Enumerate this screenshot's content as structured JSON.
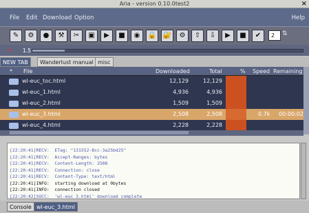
{
  "window": {
    "title": "Aria - version 0.10.0test2",
    "close_glyph": "×"
  },
  "menu": {
    "file": "File",
    "edit": "Edit",
    "download": "Download",
    "option": "Option",
    "help": "Help"
  },
  "toolbar": {
    "buttons": [
      {
        "icon": "pencil-icon",
        "glyph": "✎"
      },
      {
        "icon": "gear-icon",
        "glyph": "⚙"
      },
      {
        "icon": "orange-circle-icon",
        "glyph": "●"
      },
      {
        "icon": "wrench-icon",
        "glyph": "⚒"
      },
      {
        "icon": "scissors-icon",
        "glyph": "✂"
      },
      {
        "icon": "box-icon",
        "glyph": "▣"
      },
      {
        "icon": "play-icon",
        "glyph": "▶"
      },
      {
        "icon": "stop-icon",
        "glyph": "■"
      },
      {
        "icon": "record-icon",
        "glyph": "◉"
      },
      {
        "icon": "lock-icon",
        "glyph": "🔒"
      },
      {
        "icon": "lock-alt-icon",
        "glyph": "🔐"
      },
      {
        "icon": "settings-icon",
        "glyph": "⚙"
      },
      {
        "icon": "arrow-up-icon",
        "glyph": "⇧"
      },
      {
        "icon": "arrow-down-icon",
        "glyph": "⇩"
      },
      {
        "icon": "play-small-icon",
        "glyph": "▶"
      },
      {
        "icon": "stop-small-icon",
        "glyph": "■"
      },
      {
        "icon": "check-icon",
        "glyph": "✔"
      }
    ],
    "thread_count": "2",
    "spin_arrows": "⇅"
  },
  "speed": {
    "label": "1.5",
    "level": 0.12
  },
  "tabs": [
    {
      "label": "NEW TAB",
      "active": true
    },
    {
      "label": "Wanderlust manual",
      "active": false
    },
    {
      "label": "misc",
      "active": false
    }
  ],
  "columns": {
    "sel": "*",
    "file": "File",
    "downloaded": "Downloaded",
    "total": "Total",
    "percent": "%",
    "speed": "Speed",
    "remaining": "Remaining"
  },
  "files": [
    {
      "name": "wl-euc_toc.html",
      "downloaded": "12,129",
      "total": "12,129",
      "speed": "",
      "remaining": "",
      "selected": false
    },
    {
      "name": "wl-euc_1.html",
      "downloaded": "4,936",
      "total": "4,936",
      "speed": "",
      "remaining": "",
      "selected": false
    },
    {
      "name": "wl-euc_2.html",
      "downloaded": "1,509",
      "total": "1,509",
      "speed": "",
      "remaining": "",
      "selected": false
    },
    {
      "name": "wl-euc_3.html",
      "downloaded": "2,508",
      "total": "2,508",
      "speed": "0.7k",
      "remaining": "00:00:02",
      "selected": true
    },
    {
      "name": "wl-euc_4.html",
      "downloaded": "2,228",
      "total": "2,228",
      "speed": "",
      "remaining": "",
      "selected": false
    }
  ],
  "log": [
    {
      "text": "[22:20:41]RECV:  ETag: \"131552-8cc-3a25bd25\"",
      "bold": false
    },
    {
      "text": "[22:20:41]RECV:  Accept-Ranges: bytes",
      "bold": false
    },
    {
      "text": "[22:20:41]RECV:  Content-Length: 2508",
      "bold": false
    },
    {
      "text": "[22:20:41]RECV:  Connection: close",
      "bold": false
    },
    {
      "text": "[22:20:41]RECV:  Content-Type: text/html",
      "bold": false
    },
    {
      "text": "[22:20:41]INFO:  starting download at 0bytes",
      "bold": true
    },
    {
      "text": "[22:20:41]INFO:  connection closed",
      "bold": true
    },
    {
      "text": "[22:20:42]SUCC:  'wl-euc_3.html' download complete",
      "bold": false
    }
  ],
  "bottom_tabs": [
    {
      "label": "Console",
      "active": false
    },
    {
      "label": "wl-euc_3.html",
      "active": true
    }
  ]
}
